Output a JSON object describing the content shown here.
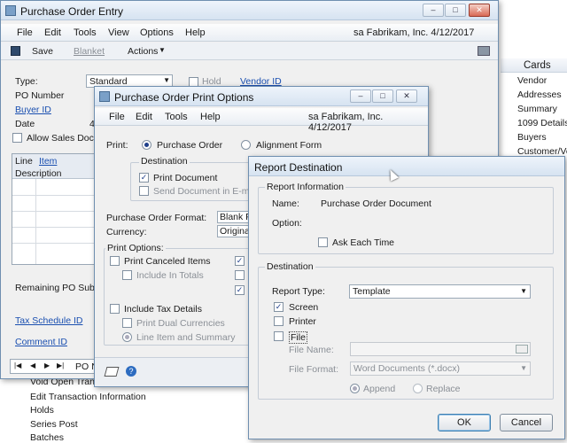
{
  "po_window": {
    "title": "Purchase Order Entry",
    "menu": [
      "File",
      "Edit",
      "Tools",
      "View",
      "Options",
      "Help"
    ],
    "user_info": "sa  Fabrikam, Inc.  4/12/2017",
    "toolbar": {
      "save": "Save",
      "blanket": "Blanket",
      "actions": "Actions"
    },
    "fields": {
      "type_label": "Type:",
      "type_value": "Standard",
      "hold_label": "Hold",
      "vendor_id_label": "Vendor ID",
      "po_number_label": "PO Number",
      "buyer_id_label": "Buyer ID",
      "date_label": "Date",
      "date_value": "4",
      "allow_sales_label": "Allow Sales Docum",
      "col_line": "Line",
      "col_item": "Item",
      "col_description": "Description",
      "remaining_label": "Remaining PO Subtota",
      "tax_schedule_label": "Tax Schedule ID",
      "comment_label": "Comment ID",
      "nav_po": "PO N"
    }
  },
  "cards_panel": {
    "header": "Cards",
    "items": [
      "Vendor",
      "Addresses",
      "Summary",
      "1099 Details",
      "Buyers",
      "Customer/Ve"
    ]
  },
  "behind_list": [
    "Void Open Trans",
    "Edit Transaction Information",
    "Holds",
    "Series Post",
    "Batches"
  ],
  "print_options": {
    "title": "Purchase Order Print Options",
    "menu": [
      "File",
      "Edit",
      "Tools",
      "Help"
    ],
    "user_info": "sa  Fabrikam, Inc.  4/12/2017",
    "print_label": "Print:",
    "print_po": "Purchase Order",
    "print_align": "Alignment Form",
    "destination_title": "Destination",
    "print_document": "Print Document",
    "send_email": "Send Document in E-mail",
    "po_format_label": "Purchase Order Format:",
    "po_format_value": "Blank Pa",
    "currency_label": "Currency:",
    "currency_value": "Originati",
    "print_options_title": "Print Options:",
    "print_canceled": "Print Canceled Items",
    "include_totals": "Include In Totals",
    "include_tax": "Include Tax Details",
    "print_dual": "Print Dual Currencies",
    "line_item_summary": "Line Item and Summary"
  },
  "report_destination": {
    "title": "Report Destination",
    "info_group": "Report Information",
    "name_label": "Name:",
    "name_value": "Purchase Order Document",
    "option_label": "Option:",
    "ask_each_time": "Ask Each Time",
    "dest_group": "Destination",
    "report_type_label": "Report Type:",
    "report_type_value": "Template",
    "screen": "Screen",
    "printer": "Printer",
    "file": "File",
    "file_name_label": "File Name:",
    "file_format_label": "File Format:",
    "file_format_value": "Word Documents (*.docx)",
    "append": "Append",
    "replace": "Replace",
    "ok": "OK",
    "cancel": "Cancel"
  }
}
